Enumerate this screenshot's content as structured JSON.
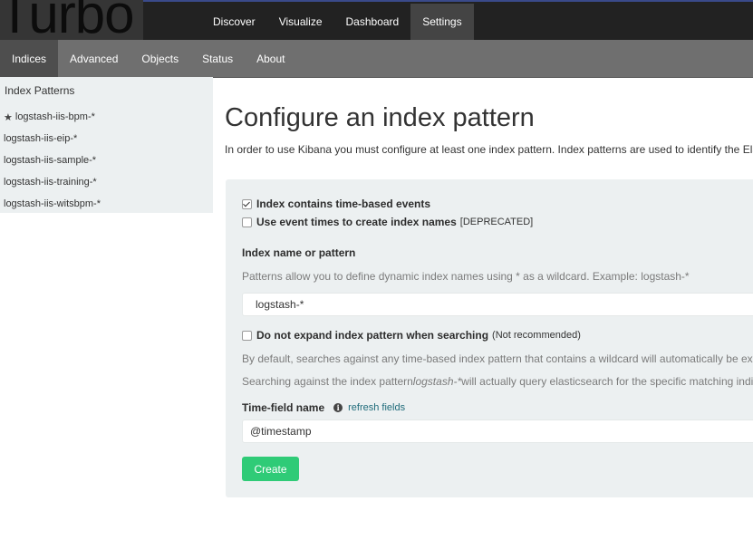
{
  "app": {
    "logo_text": "Turbo"
  },
  "topnav": {
    "items": [
      {
        "label": "Discover"
      },
      {
        "label": "Visualize"
      },
      {
        "label": "Dashboard"
      },
      {
        "label": "Settings",
        "active": true
      }
    ]
  },
  "subnav": {
    "items": [
      {
        "label": "Indices",
        "active": true
      },
      {
        "label": "Advanced"
      },
      {
        "label": "Objects"
      },
      {
        "label": "Status"
      },
      {
        "label": "About"
      }
    ]
  },
  "sidebar": {
    "heading": "Index Patterns",
    "items": [
      {
        "label": "logstash-iis-bpm-*",
        "icon": "star-icon",
        "default": true
      },
      {
        "label": "logstash-iis-eip-*"
      },
      {
        "label": "logstash-iis-sample-*"
      },
      {
        "label": "logstash-iis-training-*"
      },
      {
        "label": "logstash-iis-witsbpm-*"
      }
    ]
  },
  "main": {
    "title": "Configure an index pattern",
    "intro": "In order to use Kibana you must configure at least one index pattern. Index patterns are used to identify the Ela"
  },
  "form": {
    "time_based": {
      "label": "Index contains time-based events",
      "checked": true
    },
    "event_times": {
      "label": "Use event times to create index names",
      "note": "[DEPRECATED]",
      "checked": false
    },
    "index_name_label": "Index name or pattern",
    "index_name_help": "Patterns allow you to define dynamic index names using * as a wildcard. Example: logstash-*",
    "index_name_value": "logstash-*",
    "no_expand": {
      "label": "Do not expand index pattern when searching",
      "note": "(Not recommended)",
      "checked": false
    },
    "expand_help_1": "By default, searches against any time-based index pattern that contains a wildcard will automatically be exp",
    "expand_help_2_prefix": "Searching against the index pattern ",
    "expand_help_2_pattern": "logstash-*",
    "expand_help_2_suffix": " will actually query elasticsearch for the specific matching indic",
    "time_field_label": "Time-field name",
    "info_icon": "info-icon",
    "refresh_link": "refresh fields",
    "time_field_value": "@timestamp",
    "create_label": "Create"
  },
  "colors": {
    "topbar": "#222222",
    "subbar": "#6f6f6f",
    "panel": "#ecf0f1",
    "create_button": "#2fcb77",
    "link": "#1f6b7a"
  }
}
